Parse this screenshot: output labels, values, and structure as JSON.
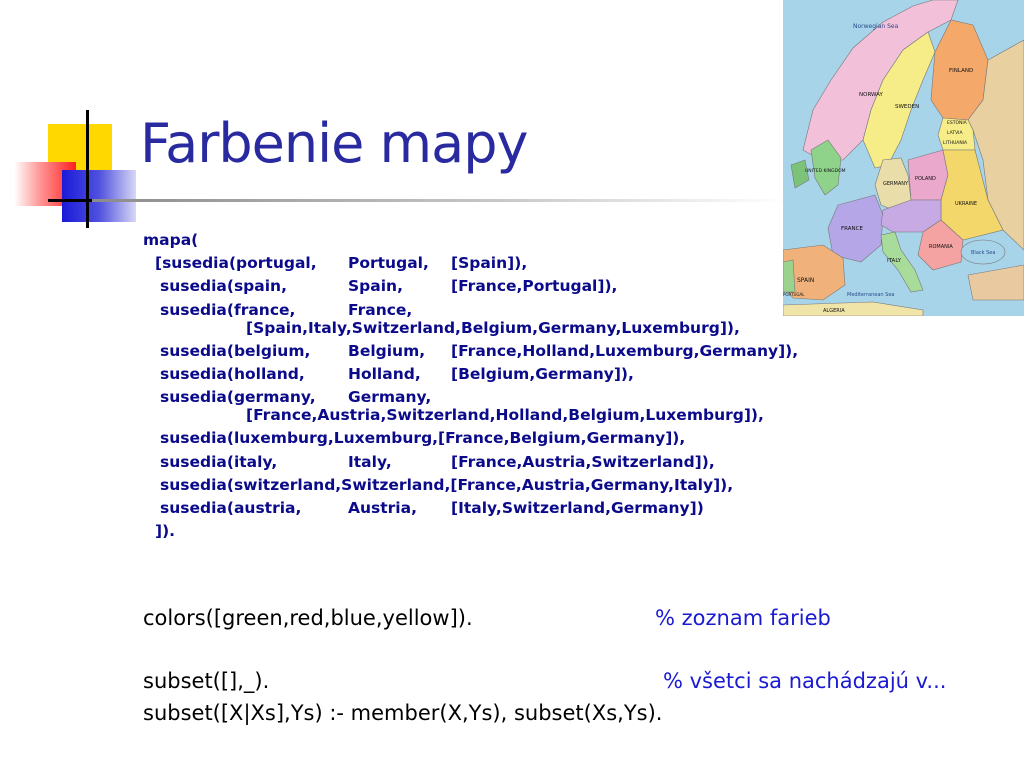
{
  "slide": {
    "title": "Farbenie mapy"
  },
  "map": {
    "labels": {
      "norwegian_sea": "Norwegian Sea",
      "finland": "FINLAND",
      "norway": "NORWAY",
      "sweden": "SWEDEN",
      "estonia": "ESTONIA",
      "latvia": "LATVIA",
      "lithuania": "LITHUANIA",
      "united_kingdom": "UNITED KINGDOM",
      "germany": "GERMANY",
      "poland": "POLAND",
      "ukraine": "UKRAINE",
      "france": "FRANCE",
      "romania": "ROMANIA",
      "spain": "SPAIN",
      "italy": "ITALY",
      "portugal": "PORTUGAL",
      "mediterranean_sea": "Mediterranean Sea",
      "algeria": "ALGERIA",
      "black_sea": "Black Sea"
    }
  },
  "code": {
    "line_01": "mapa(",
    "line_02": {
      "a": "[susedia(portugal,",
      "b": "Portugal,",
      "c": "[Spain]),"
    },
    "line_03": {
      "a": "susedia(spain,",
      "b": "Spain,",
      "c": "[France,Portugal]),"
    },
    "line_04": {
      "a": "susedia(france,",
      "b": "France,"
    },
    "line_04b": "[Spain,Italy,Switzerland,Belgium,Germany,Luxemburg]),",
    "line_05": {
      "a": "susedia(belgium,",
      "b": "Belgium,",
      "c": "[France,Holland,Luxemburg,Germany]),"
    },
    "line_06": {
      "a": "susedia(holland,",
      "b": "Holland,",
      "c": "[Belgium,Germany]),"
    },
    "line_07": {
      "a": "susedia(germany,",
      "b": "Germany,"
    },
    "line_07b": "[France,Austria,Switzerland,Holland,Belgium,Luxemburg]),",
    "line_08": "susedia(luxemburg,Luxemburg,[France,Belgium,Germany]),",
    "line_09": {
      "a": "susedia(italy,",
      "b": "Italy,",
      "c": "[France,Austria,Switzerland]),"
    },
    "line_10": "susedia(switzerland,Switzerland,[France,Austria,Germany,Italy]),",
    "line_11": {
      "a": "susedia(austria,",
      "b": "Austria,",
      "c": "[Italy,Switzerland,Germany])"
    },
    "line_12": "])."
  },
  "rules": {
    "colors": "colors([green,red,blue,yellow]).",
    "colors_comment": "% zoznam farieb",
    "subset_base": "subset([],_).",
    "subset_comment": "% všetci sa nachádzajú v...",
    "subset_rec": "subset([X|Xs],Ys) :- member(X,Ys), subset(Xs,Ys)."
  }
}
